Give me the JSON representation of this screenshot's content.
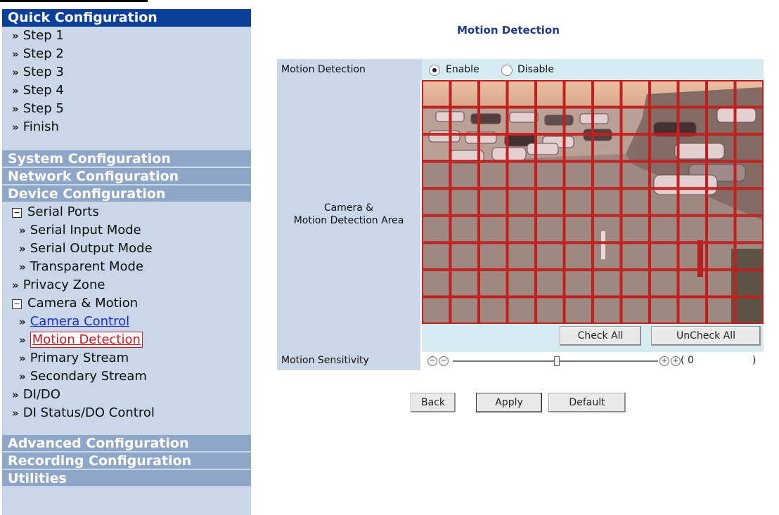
{
  "sidebar": {
    "quick": {
      "title": "Quick Configuration",
      "items": [
        "Step 1",
        "Step 2",
        "Step 3",
        "Step 4",
        "Step 5",
        "Finish"
      ]
    },
    "system": "System Configuration",
    "network": "Network Configuration",
    "device": {
      "title": "Device Configuration",
      "serial_ports": "Serial Ports",
      "serial_items": [
        "Serial Input Mode",
        "Serial Output Mode",
        "Transparent Mode"
      ],
      "privacy_zone": "Privacy Zone",
      "camera_motion": "Camera & Motion",
      "camera_items": [
        "Camera Control",
        "Motion Detection",
        "Primary Stream",
        "Secondary Stream"
      ],
      "dido": "DI/DO",
      "di_status": "DI Status/DO Control"
    },
    "advanced": "Advanced Configuration",
    "recording": "Recording Configuration",
    "utilities": "Utilities"
  },
  "main": {
    "title": "Motion Detection",
    "motion_detection_label": "Motion Detection",
    "enable_label": "Enable",
    "disable_label": "Disable",
    "enabled": true,
    "camera_area_label_1": "Camera &",
    "camera_area_label_2": "Motion Detection Area",
    "check_all": "Check All",
    "uncheck_all": "UnCheck All",
    "sensitivity_label": "Motion Sensitivity",
    "sensitivity_value": "0",
    "paren_open": "(",
    "paren_close": ")",
    "grid_cols": 12,
    "grid_rows": 9,
    "grid_color": "#c21f1f",
    "back": "Back",
    "apply": "Apply",
    "default": "Default"
  }
}
